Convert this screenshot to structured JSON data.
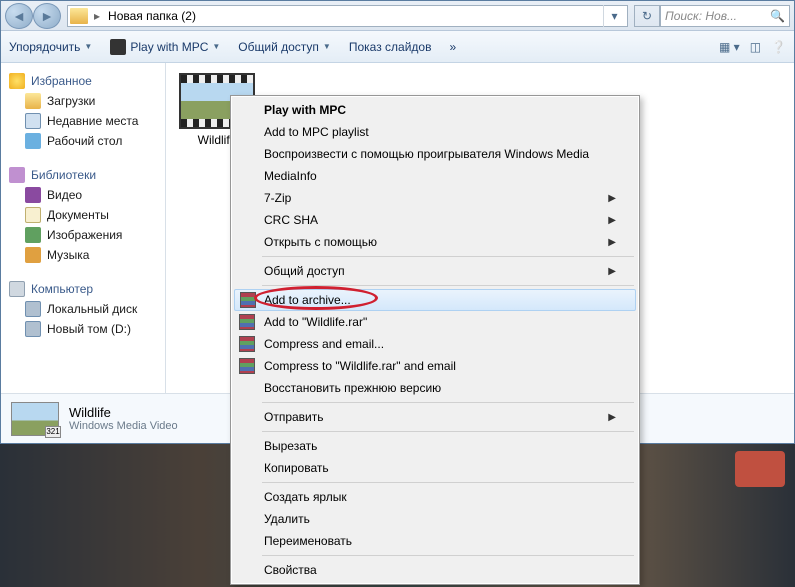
{
  "titlebar": {
    "breadcrumb_sep": "▸",
    "breadcrumb": "Новая папка (2)",
    "search_placeholder": "Поиск: Нов..."
  },
  "toolbar": {
    "organize": "Упорядочить",
    "play_mpc": "Play with MPC",
    "share": "Общий доступ",
    "slideshow": "Показ слайдов",
    "overflow": "»"
  },
  "sidebar": {
    "favorites": {
      "label": "Избранное",
      "items": [
        "Загрузки",
        "Недавние места",
        "Рабочий стол"
      ]
    },
    "libraries": {
      "label": "Библиотеки",
      "items": [
        "Видео",
        "Документы",
        "Изображения",
        "Музыка"
      ]
    },
    "computer": {
      "label": "Компьютер",
      "items": [
        "Локальный диск",
        "Новый том (D:)"
      ]
    }
  },
  "content": {
    "file_label": "Wildlife"
  },
  "details": {
    "name": "Wildlife",
    "type": "Windows Media Video"
  },
  "context_menu": {
    "items": [
      {
        "label": "Play with MPC",
        "bold": true
      },
      {
        "label": "Add to MPC playlist"
      },
      {
        "label": "Воспроизвести с помощью проигрывателя Windows Media"
      },
      {
        "label": "MediaInfo"
      },
      {
        "label": "7-Zip",
        "submenu": true
      },
      {
        "label": "CRC SHA",
        "submenu": true
      },
      {
        "label": "Открыть с помощью",
        "submenu": true
      },
      {
        "sep": true
      },
      {
        "label": "Общий доступ",
        "submenu": true
      },
      {
        "sep": true
      },
      {
        "label": "Add to archive...",
        "icon": "rar",
        "highlighted": true
      },
      {
        "label": "Add to \"Wildlife.rar\"",
        "icon": "rar"
      },
      {
        "label": "Compress and email...",
        "icon": "rar"
      },
      {
        "label": "Compress to \"Wildlife.rar\" and email",
        "icon": "rar"
      },
      {
        "label": "Восстановить прежнюю версию"
      },
      {
        "sep": true
      },
      {
        "label": "Отправить",
        "submenu": true
      },
      {
        "sep": true
      },
      {
        "label": "Вырезать"
      },
      {
        "label": "Копировать"
      },
      {
        "sep": true
      },
      {
        "label": "Создать ярлык"
      },
      {
        "label": "Удалить"
      },
      {
        "label": "Переименовать"
      },
      {
        "sep": true
      },
      {
        "label": "Свойства"
      }
    ]
  }
}
